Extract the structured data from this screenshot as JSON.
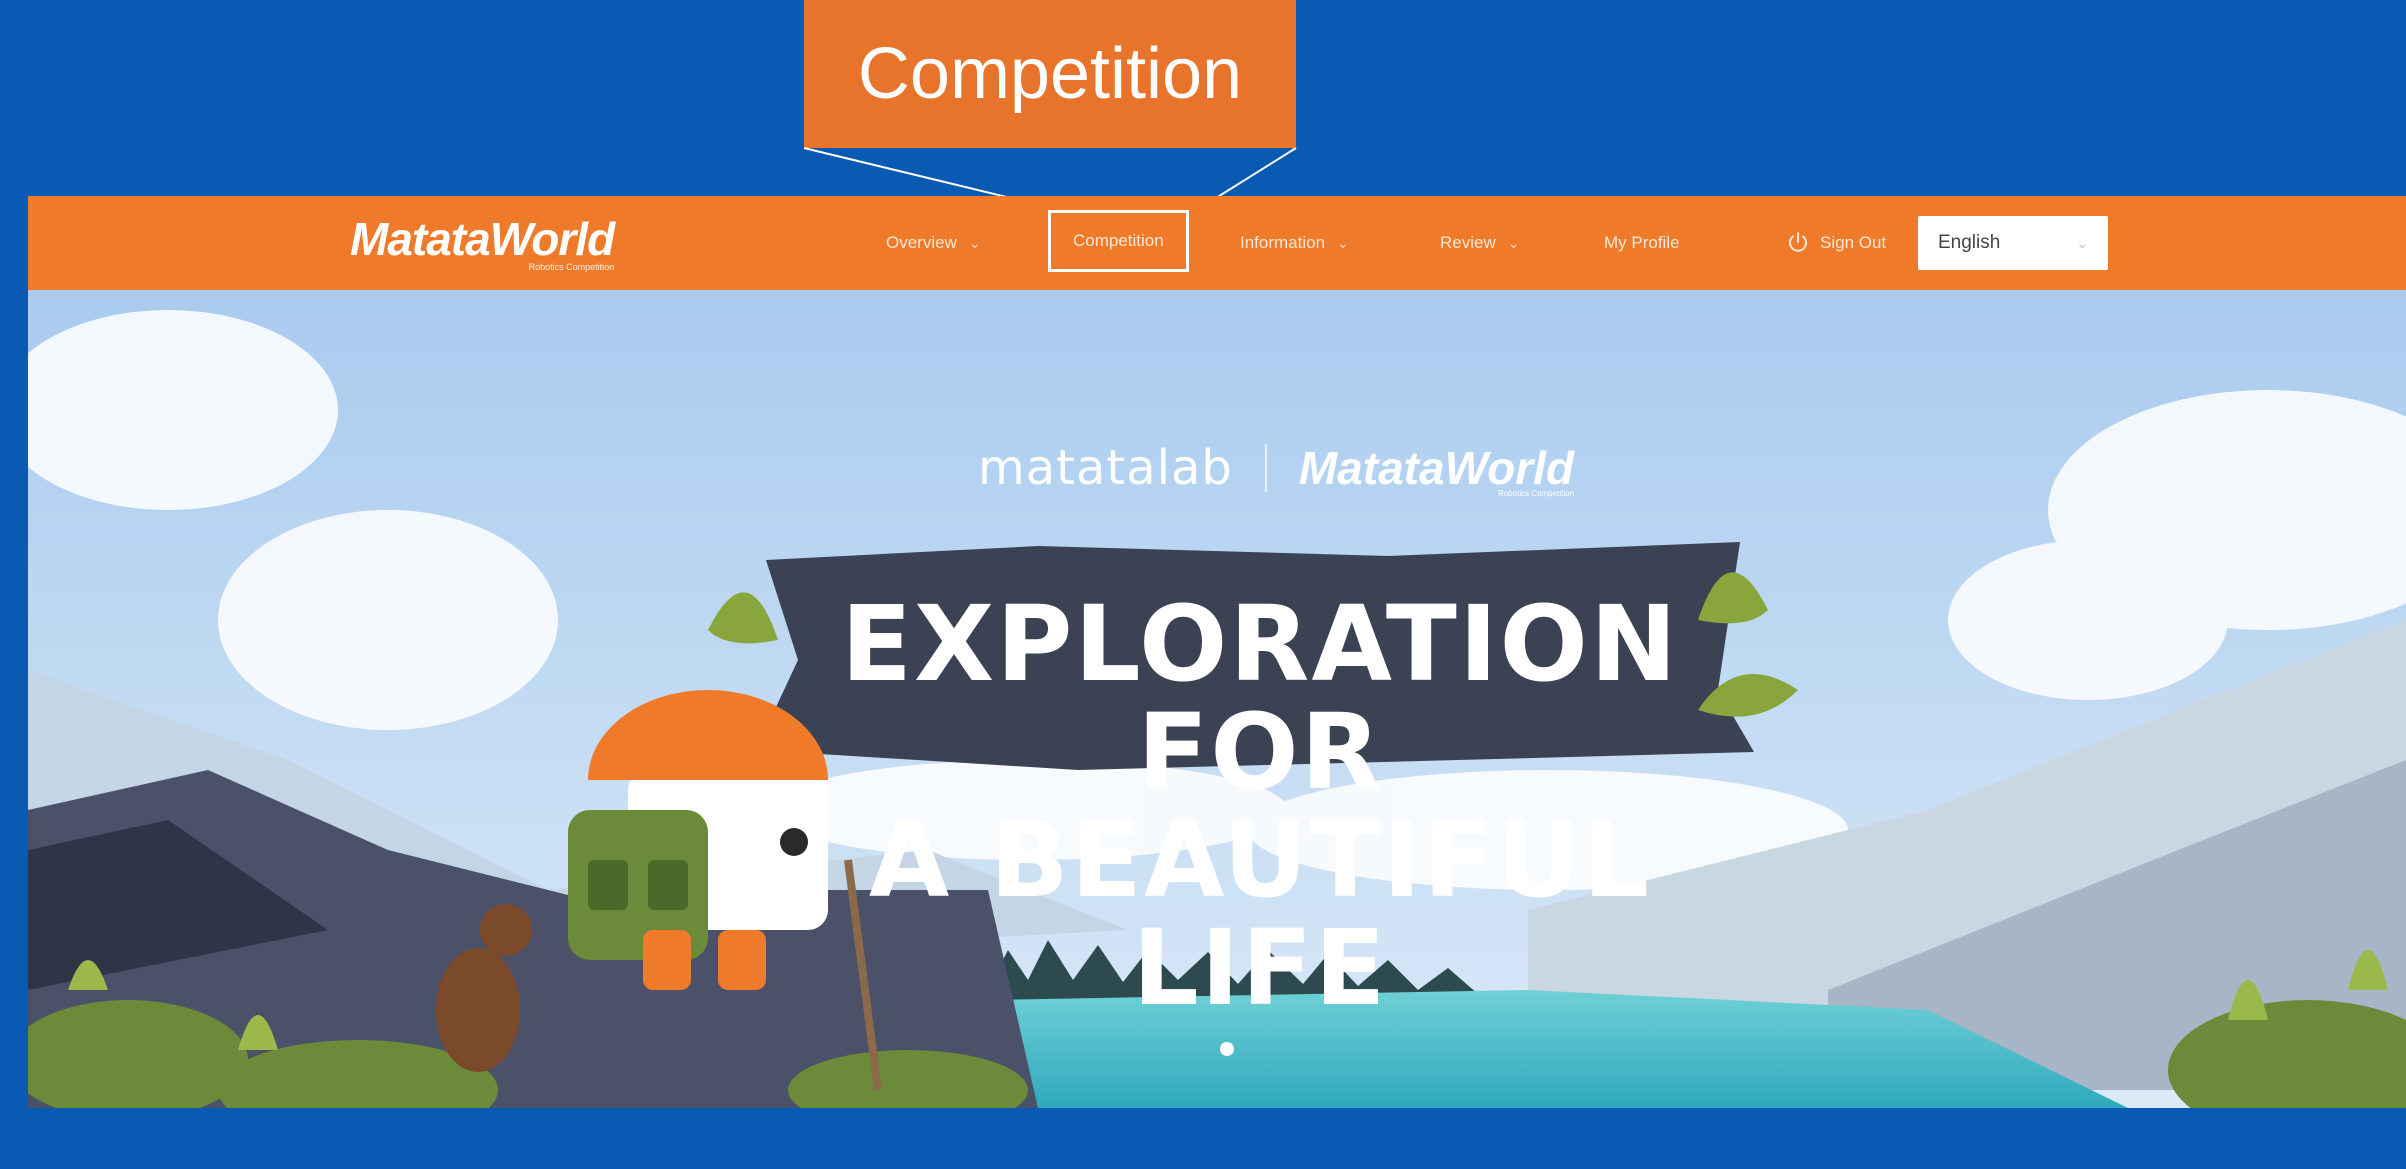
{
  "callout": {
    "label": "Competition"
  },
  "navbar": {
    "logo": {
      "main": "MatataWorld",
      "sub": "Robotics Competition"
    },
    "items": [
      {
        "label": "Overview",
        "dropdown": true
      },
      {
        "label": "Competition",
        "dropdown": false,
        "active": true
      },
      {
        "label": "Information",
        "dropdown": true
      },
      {
        "label": "Review",
        "dropdown": true
      },
      {
        "label": "My Profile",
        "dropdown": false
      }
    ],
    "sign_out": {
      "label": "Sign Out",
      "icon": "power-icon"
    },
    "language": {
      "selected": "English"
    }
  },
  "hero": {
    "brand_left": "matatalab",
    "brand_right": "MatataWorld",
    "brand_right_sub": "Robotics Competition",
    "headline_line1": "EXPLORATION FOR",
    "headline_line2": "A BEAUTIFUL LIFE",
    "carousel_dots": 1
  },
  "colors": {
    "brand_orange": "#ee7a2a",
    "callout_orange": "#e8732b",
    "background_blue": "#0a5ab4",
    "sky": "#b5d4f1"
  }
}
